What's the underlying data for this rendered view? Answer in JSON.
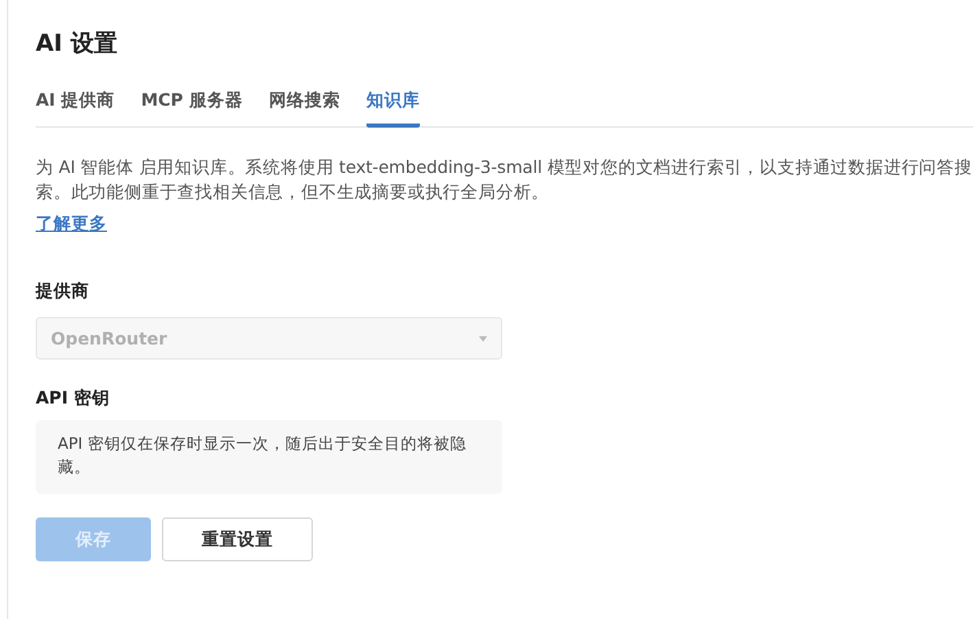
{
  "title": "AI 设置",
  "tabs": [
    {
      "label": "AI 提供商",
      "selected": false
    },
    {
      "label": "MCP 服务器",
      "selected": false
    },
    {
      "label": "网络搜索",
      "selected": false
    },
    {
      "label": "知识库",
      "selected": true
    }
  ],
  "description": "为 AI 智能体 启用知识库。系统将使用 text-embedding-3-small 模型对您的文档进行索引，以支持通过数据进行问答搜索。此功能侧重于查找相关信息，但不生成摘要或执行全局分析。",
  "learn_more_link": "了解更多",
  "provider": {
    "label": "提供商",
    "value": "OpenRouter",
    "disabled": true
  },
  "api_key": {
    "label": "API 密钥",
    "notice": "API 密钥仅在保存时显示一次，随后出于安全目的将被隐藏。"
  },
  "buttons": [
    {
      "kind": "primary",
      "label": "保存",
      "disabled": true
    },
    {
      "kind": "secondary",
      "label": "重置设置",
      "disabled": false
    }
  ]
}
